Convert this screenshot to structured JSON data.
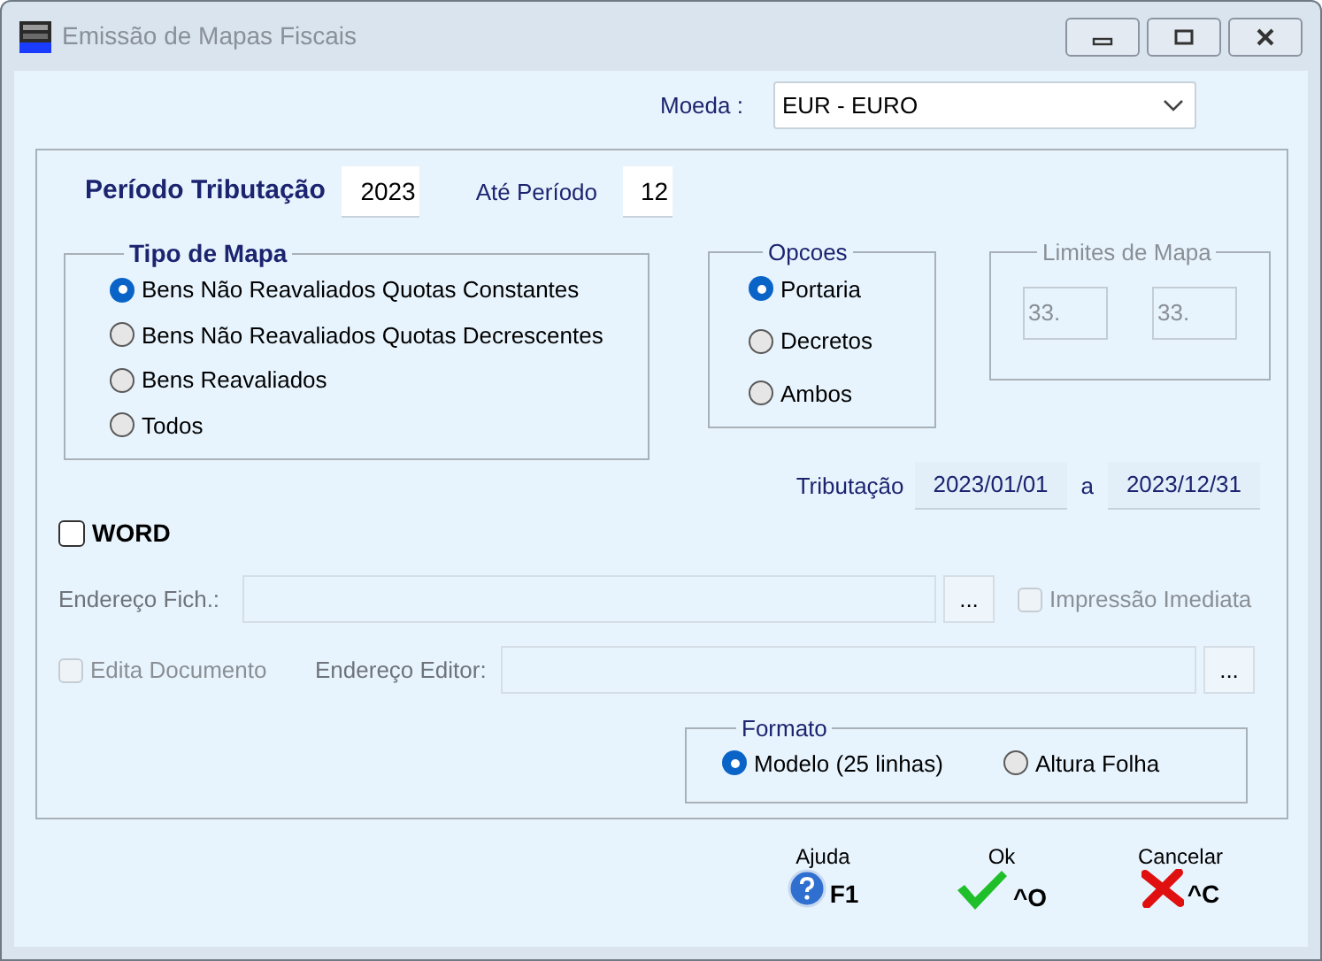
{
  "window": {
    "title": "Emissão de Mapas Fiscais"
  },
  "currency": {
    "label": "Moeda :",
    "value": "EUR - EURO"
  },
  "period": {
    "label": "Período Tributação",
    "value": "2023",
    "until_label": "Até Período",
    "until_value": "12"
  },
  "map_type": {
    "title": "Tipo de Mapa",
    "options": [
      {
        "label": "Bens Não Reavaliados Quotas Constantes",
        "selected": true
      },
      {
        "label": "Bens Não Reavaliados Quotas Decrescentes",
        "selected": false
      },
      {
        "label": "Bens Reavaliados",
        "selected": false
      },
      {
        "label": "Todos",
        "selected": false
      }
    ]
  },
  "options": {
    "title": "Opcoes",
    "options": [
      {
        "label": "Portaria",
        "selected": true
      },
      {
        "label": "Decretos",
        "selected": false
      },
      {
        "label": "Ambos",
        "selected": false
      }
    ]
  },
  "map_limits": {
    "title": "Limites de Mapa",
    "disabled": true,
    "fields": [
      "33.",
      "33."
    ]
  },
  "taxation": {
    "label": "Tributação",
    "from": "2023/01/01",
    "separator": "a",
    "to": "2023/12/31"
  },
  "word": {
    "label": "WORD",
    "checked": false
  },
  "file_path": {
    "label": "Endereço Fich.:",
    "browse": "...",
    "disabled": true
  },
  "print_now": {
    "label": "Impressão Imediata",
    "checked": false,
    "disabled": true
  },
  "edit_document": {
    "label": "Edita Documento",
    "checked": false,
    "disabled": true
  },
  "editor_path": {
    "label": "Endereço Editor:",
    "browse": "...",
    "disabled": true
  },
  "format": {
    "title": "Formato",
    "options": [
      {
        "label": "Modelo (25 linhas)",
        "selected": true
      },
      {
        "label": "Altura Folha",
        "selected": false
      }
    ]
  },
  "buttons": [
    {
      "kind": "help",
      "label": "Ajuda",
      "shortcut": "F1"
    },
    {
      "kind": "ok",
      "label": "Ok",
      "shortcut": "^O"
    },
    {
      "kind": "cancel",
      "label": "Cancelar",
      "shortcut": "^C"
    }
  ]
}
